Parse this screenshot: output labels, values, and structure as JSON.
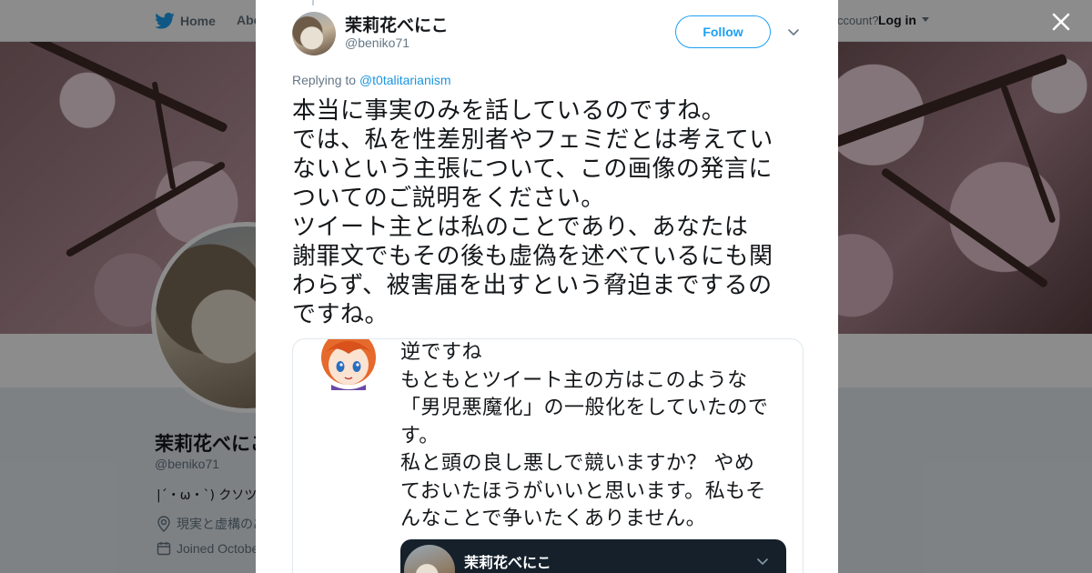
{
  "nav": {
    "home_label": "Home",
    "about_label": "Abo",
    "account_prompt": "ccount?",
    "login_label": "Log in"
  },
  "profile": {
    "name": "茉莉花べにこ",
    "handle": "@beniko71",
    "bio": "|´・ω・`) クソツ",
    "location": "現実と虚構のあ",
    "joined": "Joined Octobe"
  },
  "tweet": {
    "author_name": "茉莉花べにこ",
    "author_handle": "@beniko71",
    "follow_label": "Follow",
    "replying_prefix": "Replying to",
    "replying_to": "@t0talitarianism",
    "text_lines": [
      "本当に事実のみを話しているのですね。",
      "では、私を性差別者やフェミだとは考えてい",
      "ないという主張について、この画像の発言に",
      "ついてのご説明をください。",
      "ツイート主とは私のことであり、あなたは",
      "謝罪文でもその後も虚偽を述べているにも関",
      "わらず、被害届を出すという脅迫までするの",
      "ですね。"
    ]
  },
  "media": {
    "lines": [
      "逆ですね",
      "もともとツイート主の方はこのような",
      "「男児悪魔化」の一般化をしていたので",
      "す。",
      "私と頭の良し悪しで競いますか？ やめ",
      "ておいたほうがいいと思います。私もそ",
      "んなことで争いたくありません。"
    ],
    "embedded_name": "茉莉花べにこ"
  },
  "colors": {
    "twitter_blue": "#1da1f2",
    "link_blue": "#1b95e0",
    "text": "#14171a",
    "muted": "#657786"
  }
}
